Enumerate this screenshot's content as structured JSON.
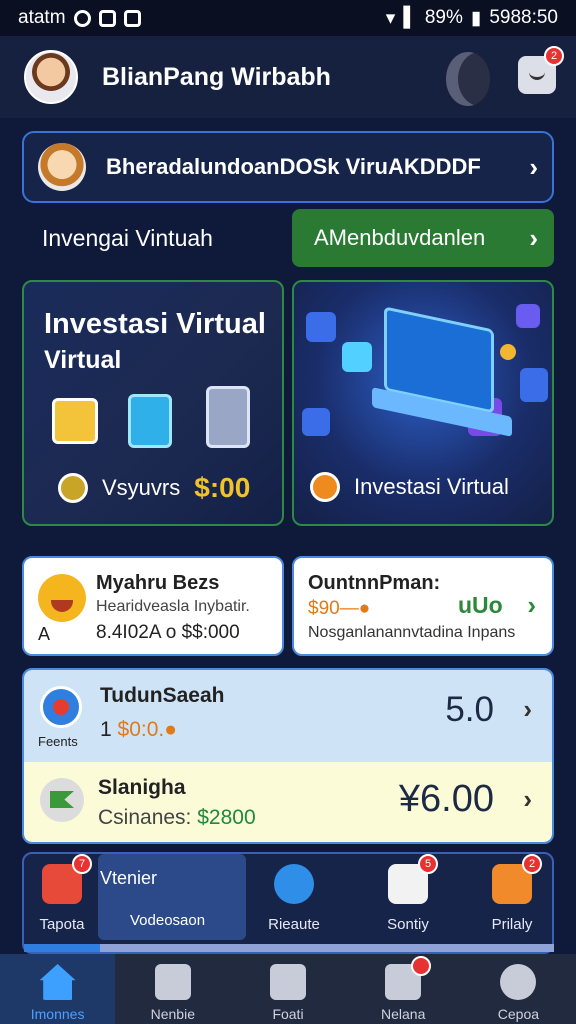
{
  "status": {
    "carrier": "atatm",
    "battery": "89%",
    "time": "5988:50"
  },
  "header": {
    "title": "BlianPang Wirbabh",
    "chat_badge": "2"
  },
  "banner": {
    "text": "BheradalundoanDOSk ViruAKDDDF"
  },
  "row": {
    "label": "Invengai Vintuah",
    "button": "AMenbduvdanlen"
  },
  "card_invest": {
    "title1": "Investasi Virtual",
    "title2": "Virtual",
    "foot_label": "Vsyuvrs",
    "foot_amount": "$:00"
  },
  "card_laptop": {
    "foot_label": "Investasi Virtual"
  },
  "widget1": {
    "title": "Myahru Bezs",
    "subtitle": "Hearidveasla Inybatir.",
    "prefix": "A",
    "line": "8.4I02A o $$:000"
  },
  "widget2": {
    "title": "OuntnnPman:",
    "amount": "$90—●",
    "value": "uUo",
    "note": "Nosganlanannvtadina Inpans"
  },
  "list": [
    {
      "title": "TudunSaeah",
      "sub_icon_label": "Feents",
      "amount_prefix": "1",
      "amount": "$0:0.●",
      "value": "5.0"
    },
    {
      "title": "Slanigha",
      "amount_label": "Csinanes:",
      "amount": "$2800",
      "value": "¥6.00"
    }
  ],
  "apps": [
    {
      "label": "Tapota",
      "badge": "7"
    },
    {
      "label": "Vodeosaon",
      "top": "Vtenier"
    },
    {
      "label": "Rieaute"
    },
    {
      "label": "Sontiy",
      "badge": "5"
    },
    {
      "label": "Prilaly",
      "badge": "2"
    }
  ],
  "nav": [
    {
      "label": "Imonnes"
    },
    {
      "label": "Nenbie"
    },
    {
      "label": "Foati"
    },
    {
      "label": "Nelana"
    },
    {
      "label": "Cepoa"
    }
  ]
}
